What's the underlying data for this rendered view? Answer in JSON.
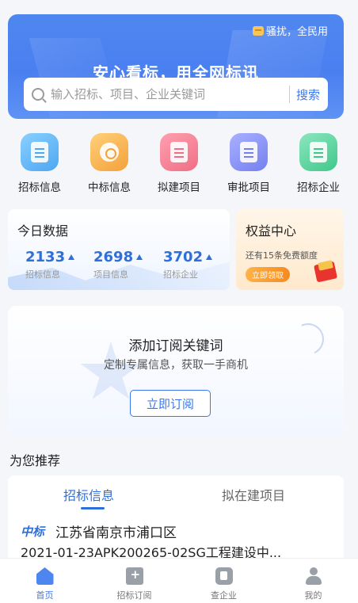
{
  "header": {
    "tag_text": "骚扰，全民用",
    "title": "安心看标，用全网标讯",
    "search": {
      "placeholder": "输入招标、项目、企业关键词",
      "button_label": "搜索"
    }
  },
  "quick_nav": [
    {
      "label": "招标信息",
      "icon": "document-icon",
      "color": "#4da7f1"
    },
    {
      "label": "中标信息",
      "icon": "target-icon",
      "color": "#f3a13a"
    },
    {
      "label": "拟建项目",
      "icon": "mail-icon",
      "color": "#ef6f85"
    },
    {
      "label": "审批项目",
      "icon": "card-icon",
      "color": "#7480f0"
    },
    {
      "label": "招标企业",
      "icon": "building-icon",
      "color": "#3ec88a"
    }
  ],
  "today_stats": {
    "title": "今日数据",
    "items": [
      {
        "value": "2133",
        "label": "招标信息"
      },
      {
        "value": "2698",
        "label": "项目信息"
      },
      {
        "value": "3702",
        "label": "招标企业"
      }
    ]
  },
  "benefit": {
    "title": "权益中心",
    "desc": "还有15条免费额度",
    "button_label": "立即领取"
  },
  "subscribe": {
    "title": "添加订阅关键词",
    "desc": "定制专属信息，获取一手商机",
    "button_label": "立即订阅"
  },
  "recommend": {
    "section_title": "为您推荐",
    "tabs": [
      "招标信息",
      "拟在建项目"
    ],
    "active_tab": 0,
    "items": [
      {
        "badge": "中标",
        "location": "江苏省南京市浦口区",
        "title": "2021-01-23APK200265-02SG工程建设中..."
      }
    ]
  },
  "tabbar": {
    "items": [
      {
        "label": "首页",
        "icon": "home-icon"
      },
      {
        "label": "招标订阅",
        "icon": "subscribe-icon"
      },
      {
        "label": "查企业",
        "icon": "company-icon"
      },
      {
        "label": "我的",
        "icon": "user-icon"
      }
    ],
    "active": 0
  },
  "colors": {
    "accent": "#3a78f0",
    "banner": "#4f87f0",
    "stat_number": "#2e6fd8",
    "benefit_button": "#f58a1f"
  }
}
